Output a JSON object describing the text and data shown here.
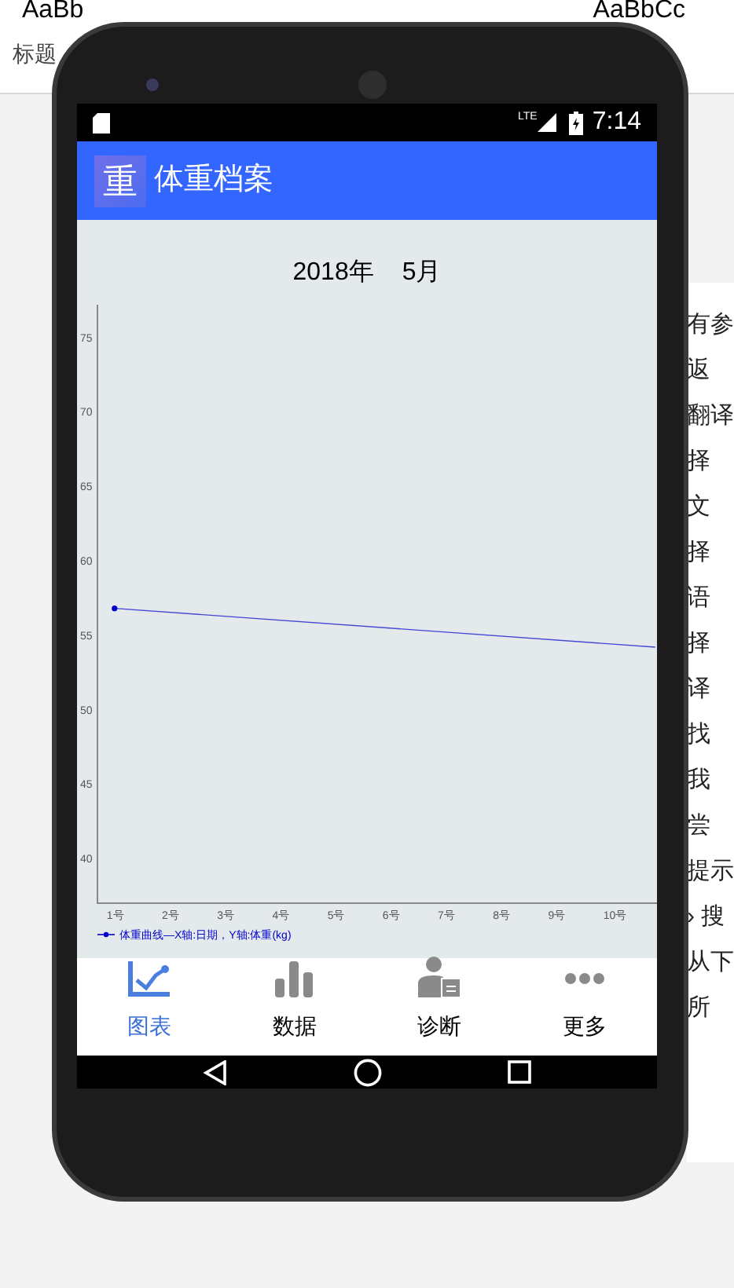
{
  "document": {
    "ribbon_styles": [
      "AaBb",
      "AaBbCc"
    ],
    "style_label": "标题",
    "side_fragments": [
      "有参",
      "返",
      "翻译",
      "择",
      "文",
      "择",
      "语",
      "择",
      "译",
      "找",
      "我",
      "尝",
      "提示",
      "› 搜",
      "从下",
      "所"
    ]
  },
  "status_bar": {
    "network": "LTE",
    "time": "7:14"
  },
  "app_bar": {
    "logo": "重",
    "title": "体重档案"
  },
  "date": {
    "year": "2018年",
    "month": "5月"
  },
  "chart": {
    "legend": "—X轴:日期，Y轴:体重(kg)",
    "chart_data": {
      "type": "line",
      "x": [
        1,
        10.8
      ],
      "xlim": [
        0.69,
        10.83
      ],
      "ylim": [
        37,
        77.2
      ],
      "xticks": [
        {
          "value": 1,
          "label": "1号"
        },
        {
          "value": 2,
          "label": "2号"
        },
        {
          "value": 3,
          "label": "3号"
        },
        {
          "value": 4,
          "label": "4号"
        },
        {
          "value": 5,
          "label": "5号"
        },
        {
          "value": 6,
          "label": "6号"
        },
        {
          "value": 7,
          "label": "7号"
        },
        {
          "value": 8,
          "label": "8号"
        },
        {
          "value": 9,
          "label": "9号"
        },
        {
          "value": 10,
          "label": "10号"
        }
      ],
      "yticks": [
        40,
        45,
        50,
        55,
        60,
        65,
        70,
        75
      ],
      "series": [
        {
          "name": "体重曲线",
          "color": "#0000cc",
          "values": [
            56.8,
            54.2
          ]
        }
      ]
    }
  },
  "tabs": [
    {
      "kind": "chart",
      "label": "图表",
      "selected": true
    },
    {
      "kind": "bars",
      "label": "数据",
      "selected": false
    },
    {
      "kind": "doctor",
      "label": "诊断",
      "selected": false
    },
    {
      "kind": "more",
      "label": "更多",
      "selected": false
    }
  ]
}
